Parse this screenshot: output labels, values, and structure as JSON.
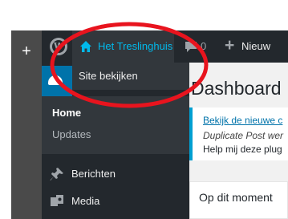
{
  "adminbar": {
    "wp_logo_icon": "wordpress-icon",
    "site_icon": "home-icon",
    "site_name": "Het Treslinghuis",
    "comments_icon": "comment-bubble-icon",
    "comment_count": "0",
    "new_icon": "plus-icon",
    "new_label": "Nieuw"
  },
  "site_dropdown": {
    "view_site_label": "Site bekijken"
  },
  "side_rail": {
    "add_icon": "plus-icon"
  },
  "admin_menu": {
    "dashboard_icon": "dashboard-gauge-icon",
    "submenu": [
      "Home",
      "Updates"
    ],
    "items": [
      {
        "icon": "pushpin-icon",
        "label": "Berichten"
      },
      {
        "icon": "media-icon",
        "label": "Media"
      }
    ]
  },
  "main": {
    "page_title": "Dashboard",
    "notice_link": "Bekijk de nieuwe c",
    "notice_plugin": "Duplicate Post wer",
    "notice_help": "Help mij deze plug",
    "widget_title": "Op dit moment"
  },
  "colors": {
    "adminbar_bg": "#23282d",
    "site_name": "#00b9eb",
    "menu_active": "#0073aa",
    "highlight_circle": "#e8141e"
  }
}
